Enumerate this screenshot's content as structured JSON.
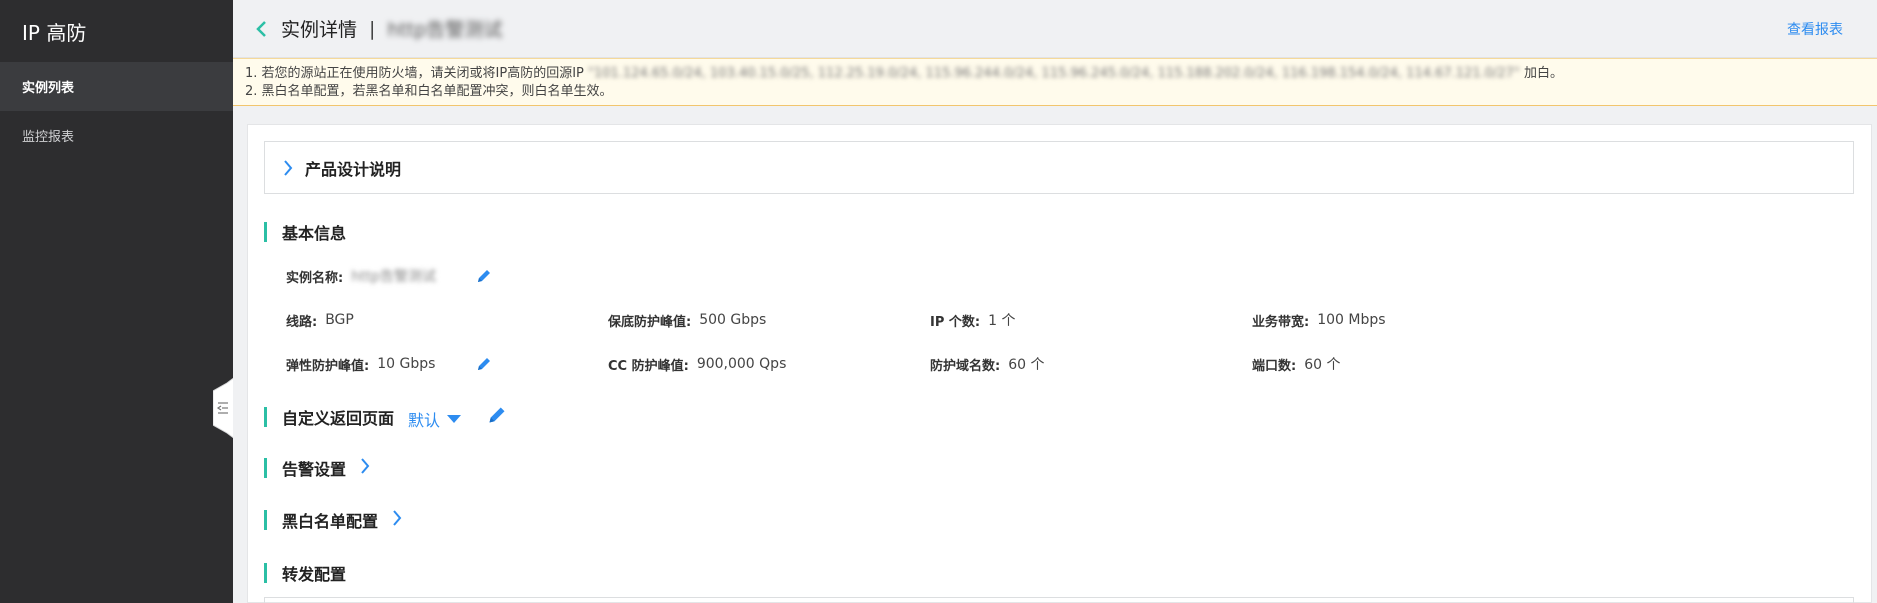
{
  "sidebar": {
    "brand": "IP 高防",
    "items": [
      {
        "label": "实例列表",
        "active": true
      },
      {
        "label": "监控报表",
        "active": false
      }
    ]
  },
  "header": {
    "title": "实例详情",
    "separator": "|",
    "instance_name": "http告警测试",
    "report_link": "查看报表"
  },
  "notice": {
    "line1_prefix": "1. 若您的源站正在使用防火墙，请关闭或将IP高防的回源IP",
    "line1_ips": "\"101.124.65.0/24, 103.40.15.0/25, 112.25.19.0/24, 115.96.244.0/24, 115.96.245.0/24, 115.188.202.0/24, 116.198.154.0/24, 114.67.121.0/27\"",
    "line1_suffix": " 加白。",
    "line2": "2. 黑白名单配置，若黑名单和白名单配置冲突，则白名单生效。"
  },
  "product_design": {
    "label": "产品设计说明"
  },
  "basic_info": {
    "title": "基本信息",
    "instance_name_label": "实例名称:",
    "instance_name_value": "http告警测试",
    "line_label": "线路:",
    "line_value": "BGP",
    "base_peak_label": "保底防护峰值:",
    "base_peak_value": "500 Gbps",
    "ip_count_label": "IP 个数:",
    "ip_count_value": "1 个",
    "bandwidth_label": "业务带宽:",
    "bandwidth_value": "100 Mbps",
    "elastic_peak_label": "弹性防护峰值:",
    "elastic_peak_value": "10 Gbps",
    "cc_peak_label": "CC 防护峰值:",
    "cc_peak_value": "900,000 Qps",
    "domain_count_label": "防护域名数:",
    "domain_count_value": "60 个",
    "port_count_label": "端口数:",
    "port_count_value": "60 个"
  },
  "custom_page": {
    "title": "自定义返回页面",
    "selected": "默认"
  },
  "alarm": {
    "title": "告警设置"
  },
  "blackwhite": {
    "title": "黑白名单配置"
  },
  "forward": {
    "title": "转发配置"
  },
  "colors": {
    "accent": "#2d8cf0",
    "section_bar": "#2bbfa5",
    "sidebar_bg": "#2d2d2f"
  }
}
